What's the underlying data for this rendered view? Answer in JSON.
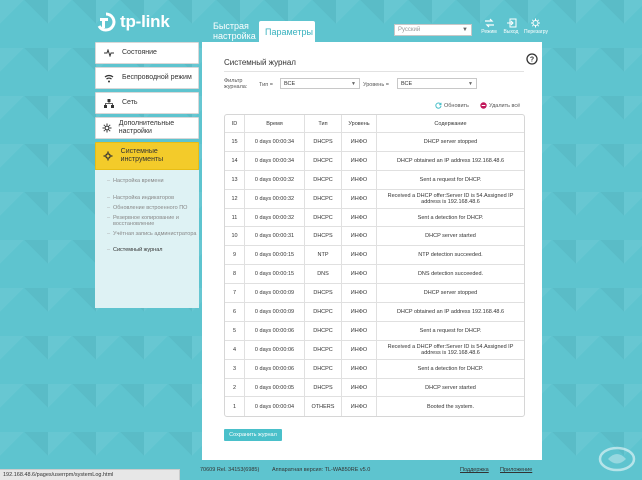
{
  "brand": {
    "logo_text": "tp-link",
    "accent": "#4ac0ca",
    "active_nav": "#f3cb2a"
  },
  "header": {
    "tabs": [
      {
        "label": "Быстрая настройка"
      },
      {
        "label": "Параметры"
      }
    ],
    "language": "Русский",
    "icons": [
      {
        "name": "mode-icon",
        "label": "Режим"
      },
      {
        "name": "logout-icon",
        "label": "Выход"
      },
      {
        "name": "reboot-icon",
        "label": "Перезагру"
      }
    ]
  },
  "sidebar": {
    "items": [
      {
        "label": "Состояние",
        "icon": "pulse-icon"
      },
      {
        "label": "Беспроводной режим",
        "icon": "wifi-icon"
      },
      {
        "label": "Сеть",
        "icon": "network-icon"
      },
      {
        "label": "Дополнительные настройки",
        "icon": "gear-icon"
      },
      {
        "label": "Системные инструменты",
        "icon": "tools-icon"
      }
    ],
    "subitems": [
      "Настройка времени",
      "Настройка индикаторов",
      "Обновление встроенного ПО",
      "Резервное копирование и восстановление",
      "Учётная запись администратора",
      "Системный журнал"
    ]
  },
  "panel": {
    "title": "Системный журнал",
    "filter_label": "Фильтр журнала:",
    "type_label": "Тип =",
    "type_value": "ВСЕ",
    "level_label": "Уровень =",
    "level_value": "ВСЕ",
    "refresh_label": "Обновить",
    "delete_label": "Удалить всё",
    "save_label": "Сохранить журнал"
  },
  "table": {
    "columns": [
      "ID",
      "Время",
      "Тип",
      "Уровень",
      "Содержание"
    ],
    "rows": [
      [
        "15",
        "0 days 00:00:34",
        "DHCPS",
        "ИНФО",
        "DHCP server stopped"
      ],
      [
        "14",
        "0 days 00:00:34",
        "DHCPC",
        "ИНФО",
        "DHCP obtained an IP address 192.168.48.6"
      ],
      [
        "13",
        "0 days 00:00:32",
        "DHCPC",
        "ИНФО",
        "Sent a request for DHCP."
      ],
      [
        "12",
        "0 days 00:00:32",
        "DHCPC",
        "ИНФО",
        "Received a DHCP offer:Server ID is 54.Assigned IP address is 192.168.48.6"
      ],
      [
        "11",
        "0 days 00:00:32",
        "DHCPC",
        "ИНФО",
        "Sent a detection for DHCP."
      ],
      [
        "10",
        "0 days 00:00:31",
        "DHCPS",
        "ИНФО",
        "DHCP server started"
      ],
      [
        "9",
        "0 days 00:00:15",
        "NTP",
        "ИНФО",
        "NTP detection succeeded."
      ],
      [
        "8",
        "0 days 00:00:15",
        "DNS",
        "ИНФО",
        "DNS detection succeeded."
      ],
      [
        "7",
        "0 days 00:00:09",
        "DHCPS",
        "ИНФО",
        "DHCP server stopped"
      ],
      [
        "6",
        "0 days 00:00:09",
        "DHCPC",
        "ИНФО",
        "DHCP obtained an IP address 192.168.48.6"
      ],
      [
        "5",
        "0 days 00:00:06",
        "DHCPC",
        "ИНФО",
        "Sent a request for DHCP."
      ],
      [
        "4",
        "0 days 00:00:06",
        "DHCPC",
        "ИНФО",
        "Received a DHCP offer:Server ID is 54.Assigned IP address is 192.168.48.6"
      ],
      [
        "3",
        "0 days 00:00:06",
        "DHCPC",
        "ИНФО",
        "Sent a detection for DHCP."
      ],
      [
        "2",
        "0 days 00:00:05",
        "DHCPS",
        "ИНФО",
        "DHCP server started"
      ],
      [
        "1",
        "0 days 00:00:04",
        "OTHERS",
        "ИНФО",
        "Booted the system."
      ]
    ]
  },
  "footer": {
    "status_url": "192.168.48.6/pages/userrpm/systemLog.html",
    "firmware": "70609 Rel. 34153(6985)",
    "hardware": "Аппаратная версия: TL-WA850RE v5.0",
    "support": "Поддержка",
    "app": "Приложение"
  }
}
